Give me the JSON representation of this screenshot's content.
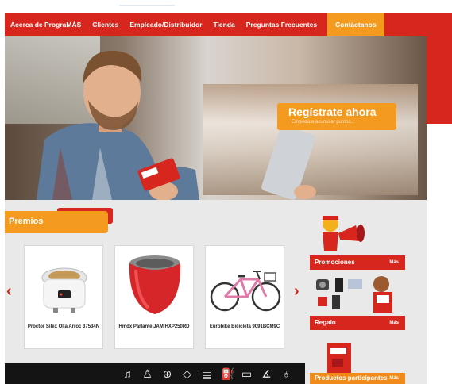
{
  "nav": {
    "items": [
      "Acerca de PrograMÁS",
      "Clientes",
      "Empleado/Distribuidor",
      "Tienda",
      "Preguntas Frecuentes"
    ],
    "contact": "Contáctanos"
  },
  "hero": {
    "register_title": "Regístrate ahora",
    "register_sub": "Empieza a acumular puntos..."
  },
  "premios": {
    "title": "Premios",
    "products": [
      {
        "name": "Proctor Silex Olla Arroc 37534N",
        "icon": "rice-cooker"
      },
      {
        "name": "Hmdx Parlante JAM HXP250RD",
        "icon": "speaker"
      },
      {
        "name": "Eurobike Bicicleta 9091BCM9C",
        "icon": "bicycle"
      }
    ]
  },
  "sidebar": {
    "promociones": "Promociones",
    "regalo": "Regalo",
    "productos": "Productos participantes",
    "mas": "Más"
  },
  "iconbar": [
    "music-icon",
    "user-icon",
    "globe-icon",
    "tag-icon",
    "receipt-icon",
    "gas-icon",
    "laptop-icon",
    "shoe-icon",
    "drink-icon"
  ],
  "colors": {
    "red": "#d7261e",
    "orange": "#f39a1f",
    "dark": "#141414"
  }
}
